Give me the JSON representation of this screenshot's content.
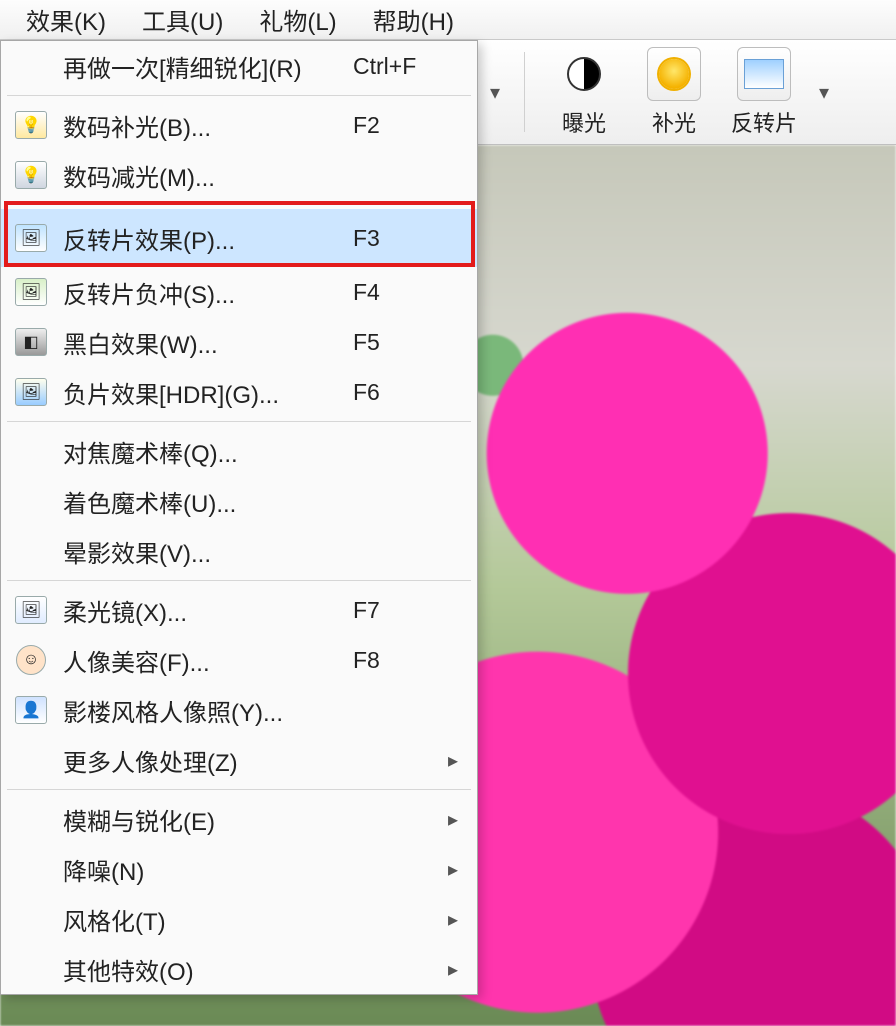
{
  "menubar": {
    "effects": "效果(K)",
    "tools": "工具(U)",
    "gifts": "礼物(L)",
    "help": "帮助(H)"
  },
  "toolbar": {
    "exposure": "曝光",
    "fill_light": "补光",
    "reversal": "反转片"
  },
  "dropdown": {
    "redo_fine_sharpen": {
      "label": "再做一次[精细锐化](R)",
      "shortcut": "Ctrl+F"
    },
    "digital_fill": {
      "label": "数码补光(B)...",
      "shortcut": "F2"
    },
    "digital_dim": {
      "label": "数码减光(M)...",
      "shortcut": ""
    },
    "reversal_effect": {
      "label": "反转片效果(P)...",
      "shortcut": "F3"
    },
    "reversal_crossprocess": {
      "label": "反转片负冲(S)...",
      "shortcut": "F4"
    },
    "bw_effect": {
      "label": "黑白效果(W)...",
      "shortcut": "F5"
    },
    "negative_hdr": {
      "label": "负片效果[HDR](G)...",
      "shortcut": "F6"
    },
    "focus_wand": {
      "label": "对焦魔术棒(Q)...",
      "shortcut": ""
    },
    "color_wand": {
      "label": "着色魔术棒(U)...",
      "shortcut": ""
    },
    "vignette": {
      "label": "晕影效果(V)...",
      "shortcut": ""
    },
    "soft_lens": {
      "label": "柔光镜(X)...",
      "shortcut": "F7"
    },
    "portrait_beauty": {
      "label": "人像美容(F)...",
      "shortcut": "F8"
    },
    "studio_portrait": {
      "label": "影楼风格人像照(Y)...",
      "shortcut": ""
    },
    "more_portrait": {
      "label": "更多人像处理(Z)",
      "shortcut": ""
    },
    "blur_sharpen": {
      "label": "模糊与锐化(E)",
      "shortcut": ""
    },
    "denoise": {
      "label": "降噪(N)",
      "shortcut": ""
    },
    "stylize": {
      "label": "风格化(T)",
      "shortcut": ""
    },
    "other_fx": {
      "label": "其他特效(O)",
      "shortcut": ""
    }
  }
}
